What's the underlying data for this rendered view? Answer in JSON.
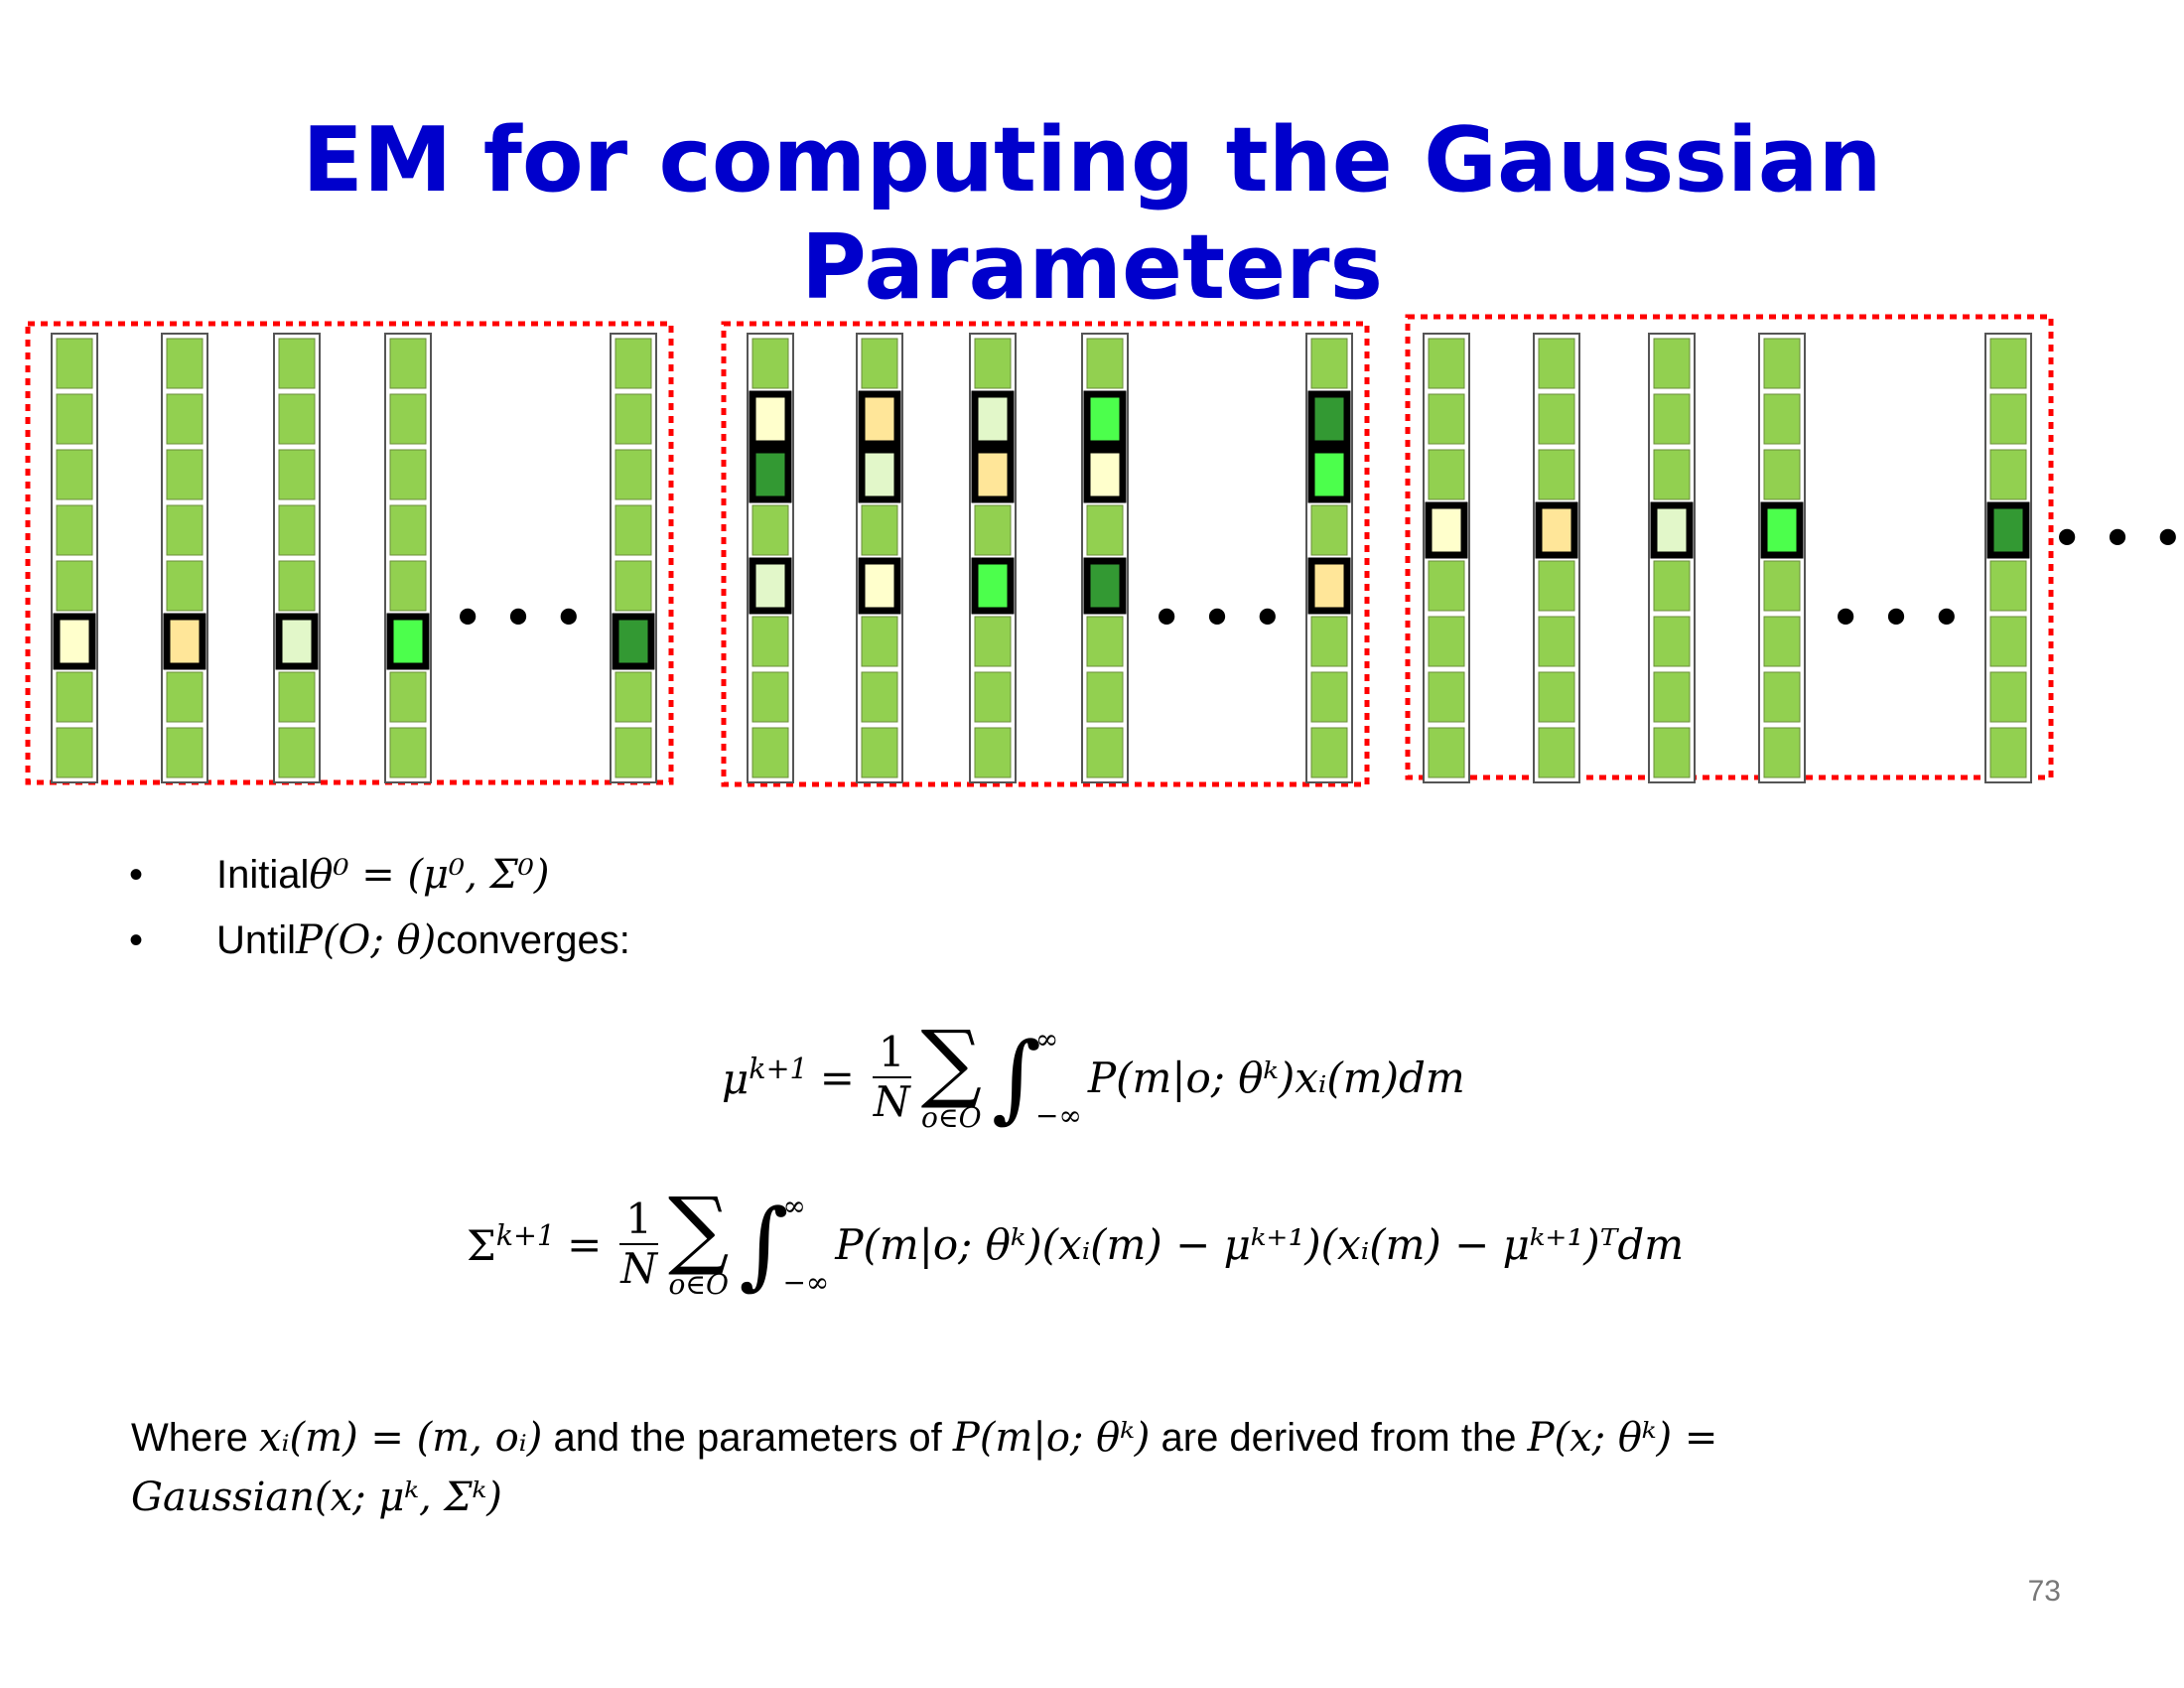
{
  "slide": {
    "title": "EM for computing the Gaussian Parameters",
    "page_number": "73"
  },
  "panels": {
    "ellipsis": "• • •",
    "trailing_ellipsis": "• • •",
    "colors": {
      "default_cell": "#92d050",
      "dashed_border": "#ff0000",
      "light_yellow": "#ffffcc",
      "light_orange": "#ffe699",
      "light_green": "#e2f7c9",
      "bright_green": "#4cff4c",
      "dark_green": "#339933"
    },
    "groups": [
      {
        "columns": [
          {
            "highlights": [
              {
                "row": 5,
                "color": "light_yellow"
              }
            ]
          },
          {
            "highlights": [
              {
                "row": 5,
                "color": "light_orange"
              }
            ]
          },
          {
            "highlights": [
              {
                "row": 5,
                "color": "light_green"
              }
            ]
          },
          {
            "highlights": [
              {
                "row": 5,
                "color": "bright_green"
              }
            ]
          },
          {
            "highlights": [
              {
                "row": 5,
                "color": "dark_green"
              }
            ]
          }
        ]
      },
      {
        "columns": [
          {
            "highlights": [
              {
                "row": 1,
                "color": "light_yellow"
              },
              {
                "row": 2,
                "color": "dark_green"
              },
              {
                "row": 4,
                "color": "light_green"
              }
            ]
          },
          {
            "highlights": [
              {
                "row": 1,
                "color": "light_orange"
              },
              {
                "row": 2,
                "color": "light_green"
              },
              {
                "row": 4,
                "color": "light_yellow"
              }
            ]
          },
          {
            "highlights": [
              {
                "row": 1,
                "color": "light_green"
              },
              {
                "row": 2,
                "color": "light_orange"
              },
              {
                "row": 4,
                "color": "bright_green"
              }
            ]
          },
          {
            "highlights": [
              {
                "row": 1,
                "color": "bright_green"
              },
              {
                "row": 2,
                "color": "light_yellow"
              },
              {
                "row": 4,
                "color": "dark_green"
              }
            ]
          },
          {
            "highlights": [
              {
                "row": 1,
                "color": "dark_green"
              },
              {
                "row": 2,
                "color": "bright_green"
              },
              {
                "row": 4,
                "color": "light_orange"
              }
            ]
          }
        ]
      },
      {
        "columns": [
          {
            "highlights": [
              {
                "row": 3,
                "color": "light_yellow"
              }
            ]
          },
          {
            "highlights": [
              {
                "row": 3,
                "color": "light_orange"
              }
            ]
          },
          {
            "highlights": [
              {
                "row": 3,
                "color": "light_green"
              }
            ]
          },
          {
            "highlights": [
              {
                "row": 3,
                "color": "bright_green"
              }
            ]
          },
          {
            "highlights": [
              {
                "row": 3,
                "color": "dark_green"
              }
            ]
          }
        ]
      }
    ]
  },
  "bullets": {
    "item1_text": "Initial ",
    "item1_math": "θ⁰ = (μ⁰, Σ⁰)",
    "item2_text": "Until ",
    "item2_math": "P(O; θ)",
    "item2_tail": " converges:"
  },
  "equations": {
    "mu_lhs": "μ",
    "mu_sup": "k+1",
    "sigma_lhs": "Σ",
    "sigma_sup": "k+1",
    "equals": "=",
    "frac_num": "1",
    "frac_den": "N",
    "sum_symbol": "∑",
    "sum_sub": "o∈O",
    "int_symbol": "∫",
    "int_upper": "∞",
    "int_lower": "−∞",
    "mu_integrand": "P(m|o; θᵏ)xᵢ(m)dm",
    "sigma_integrand": "P(m|o; θᵏ)(xᵢ(m) − μᵏ⁺¹)(xᵢ(m) − μᵏ⁺¹)ᵀdm"
  },
  "where": {
    "w1": "Where ",
    "m1": "xᵢ(m) = (m, oᵢ)",
    "w2": " and the parameters of ",
    "m2": "P(m|o; θᵏ)",
    "w3": " are derived from the ",
    "m3": "P(x; θᵏ) =",
    "m4": "Gaussian(x; μᵏ, Σᵏ)"
  }
}
